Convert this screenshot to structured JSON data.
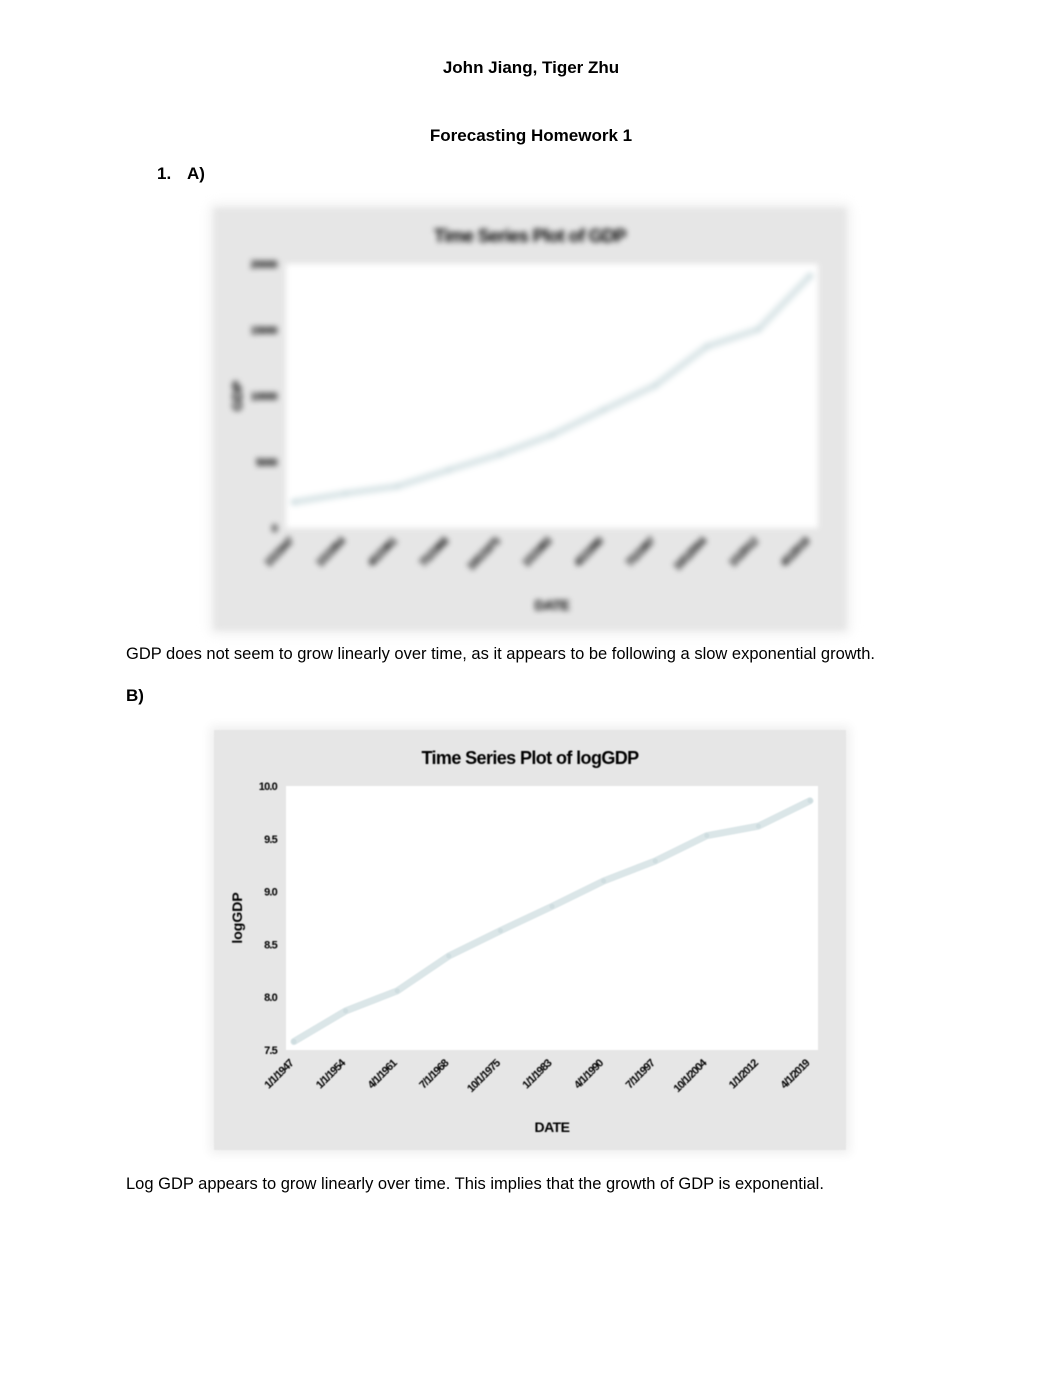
{
  "document": {
    "authors": "John Jiang, Tiger Zhu",
    "title": "Forecasting Homework 1",
    "question_number": "1.",
    "part_a_label": "A)",
    "part_a_text": "GDP does not seem to grow linearly over time, as it appears to be following a slow exponential growth.",
    "part_b_label": "B)",
    "part_b_text": "Log GDP appears to grow linearly over time. This implies that the growth of GDP is exponential."
  },
  "colors": {
    "chart_background": "#e6e6e6",
    "plot_background": "#ffffff",
    "series_line": "#cfdde0",
    "text": "#000000"
  },
  "chart_data": [
    {
      "type": "line",
      "title": "Time Series Plot of GDP",
      "xlabel": "DATE",
      "ylabel": "GDP",
      "categories": [
        "1/1/1947",
        "1/1/1954",
        "4/1/1961",
        "7/1/1968",
        "10/1/1975",
        "1/1/1983",
        "4/1/1990",
        "7/1/1997",
        "10/1/2004",
        "1/1/2012",
        "4/1/2019"
      ],
      "yticks": [
        "0",
        "5000",
        "10000",
        "15000",
        "20000"
      ],
      "ylim": [
        0,
        20000
      ],
      "grid": false,
      "series": [
        {
          "name": "GDP",
          "values": [
            1960,
            2620,
            3160,
            4400,
            5600,
            7050,
            8950,
            10800,
            13750,
            15050,
            19100
          ]
        }
      ]
    },
    {
      "type": "line",
      "title": "Time Series Plot of logGDP",
      "xlabel": "DATE",
      "ylabel": "logGDP",
      "categories": [
        "1/1/1947",
        "1/1/1954",
        "4/1/1961",
        "7/1/1968",
        "10/1/1975",
        "1/1/1983",
        "4/1/1990",
        "7/1/1997",
        "10/1/2004",
        "1/1/2012",
        "4/1/2019"
      ],
      "yticks": [
        "7.5",
        "8.0",
        "8.5",
        "9.0",
        "9.5",
        "10.0"
      ],
      "ylim": [
        7.5,
        10.0
      ],
      "grid": false,
      "series": [
        {
          "name": "logGDP",
          "values": [
            7.58,
            7.87,
            8.06,
            8.39,
            8.63,
            8.86,
            9.1,
            9.29,
            9.53,
            9.62,
            9.86
          ]
        }
      ]
    }
  ]
}
